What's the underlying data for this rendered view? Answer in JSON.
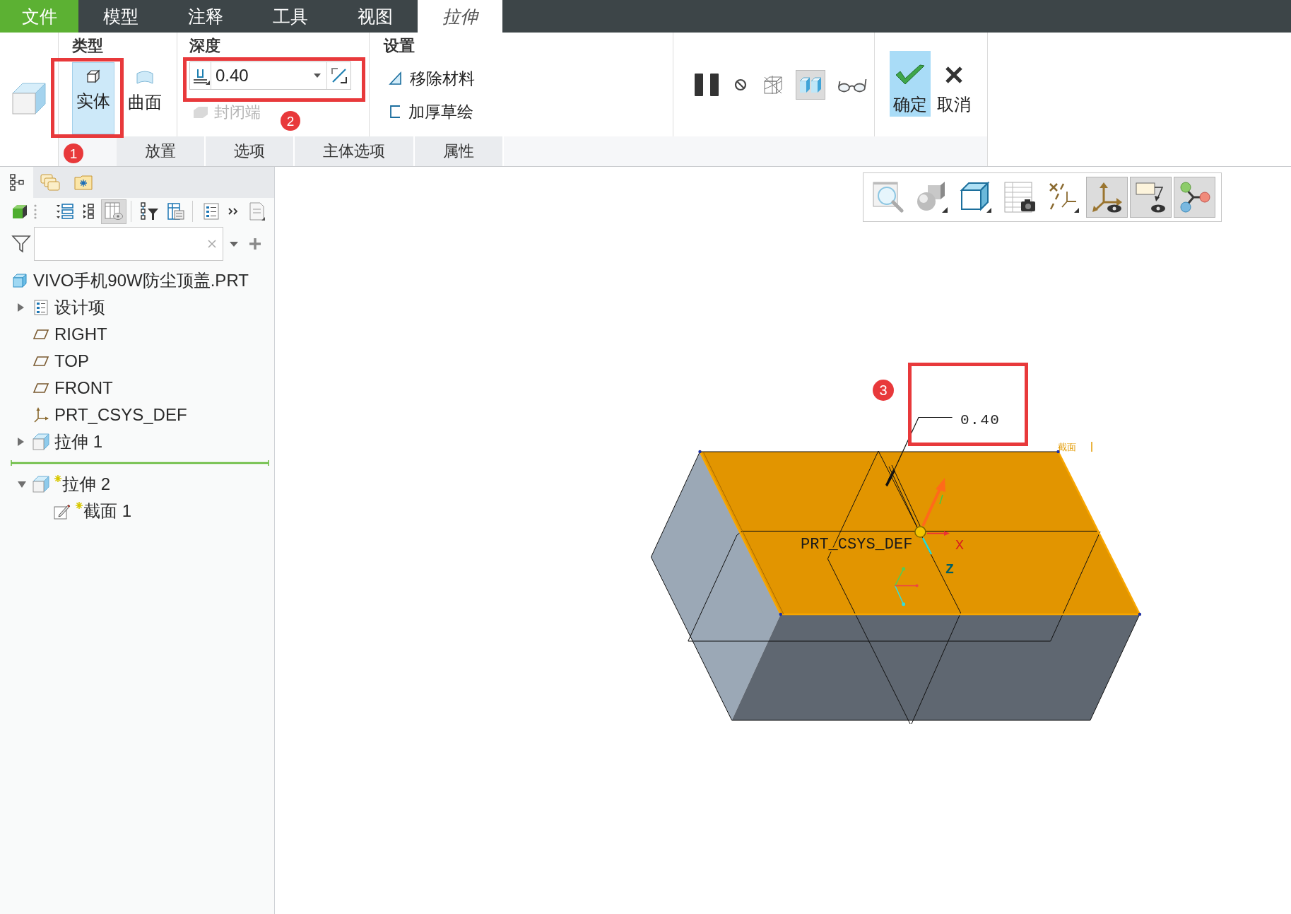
{
  "menu_bar": {
    "tabs": [
      {
        "label": "文件",
        "kind": "file",
        "selected": false
      },
      {
        "label": "模型",
        "kind": "tab",
        "selected": false
      },
      {
        "label": "注释",
        "kind": "tab",
        "selected": false
      },
      {
        "label": "工具",
        "kind": "tab",
        "selected": false
      },
      {
        "label": "视图",
        "kind": "tab",
        "selected": false
      },
      {
        "label": "拉伸",
        "kind": "tab",
        "selected": true
      }
    ]
  },
  "ribbon": {
    "type_group": {
      "title": "类型",
      "options": [
        {
          "label": "实体",
          "kind": "solid",
          "selected": true
        },
        {
          "label": "曲面",
          "kind": "surface",
          "selected": false
        }
      ],
      "callout": {
        "number": "1"
      }
    },
    "depth_group": {
      "title": "深度",
      "value": "0.40",
      "capped_ends": {
        "label": "封闭端",
        "disabled": true
      },
      "callout": {
        "number": "2"
      }
    },
    "settings_group": {
      "title": "设置",
      "options": [
        {
          "label": "移除材料",
          "kind": "remove_material",
          "on": false
        },
        {
          "label": "加厚草绘",
          "kind": "thicken",
          "on": false
        }
      ]
    },
    "preview_tools": [
      {
        "kind": "pause",
        "selected": false
      },
      {
        "kind": "no_preview",
        "selected": false
      },
      {
        "kind": "wireframe",
        "selected": false
      },
      {
        "kind": "verify",
        "selected": true
      },
      {
        "kind": "glasses",
        "selected": false
      }
    ],
    "actions": [
      {
        "label": "确定",
        "kind": "ok",
        "selected": true
      },
      {
        "label": "取消",
        "kind": "cancel",
        "selected": false
      }
    ],
    "sub_tabs": [
      {
        "label": "放置",
        "selected": false
      },
      {
        "label": "选项",
        "selected": false
      },
      {
        "label": "主体选项",
        "selected": false
      },
      {
        "label": "属性",
        "selected": false
      }
    ]
  },
  "model_tree_panel": {
    "panel_tabs": [
      {
        "kind": "model_tree",
        "selected": true
      },
      {
        "kind": "layers",
        "selected": false
      },
      {
        "kind": "folder",
        "selected": false
      }
    ],
    "toolbar": [
      {
        "kind": "display",
        "selected": false
      },
      {
        "kind": "expand",
        "selected": false
      },
      {
        "kind": "collapse",
        "selected": false
      },
      {
        "kind": "columns",
        "selected": true
      },
      {
        "kind": "tree_filter",
        "selected": false
      },
      {
        "kind": "table",
        "selected": false
      },
      {
        "kind": "list",
        "selected": false
      },
      {
        "kind": "more",
        "selected": false
      },
      {
        "kind": "document",
        "selected": false
      }
    ],
    "tree": [
      {
        "label": "VIVO手机90W防尘顶盖.PRT",
        "kind": "part",
        "new": false,
        "children": [
          {
            "label": "设计项",
            "kind": "design_items",
            "new": false,
            "expanded": false
          },
          {
            "label": "RIGHT",
            "kind": "plane",
            "new": false
          },
          {
            "label": "TOP",
            "kind": "plane",
            "new": false
          },
          {
            "label": "FRONT",
            "kind": "plane",
            "new": false
          },
          {
            "label": "PRT_CSYS_DEF",
            "kind": "csys",
            "new": false
          },
          {
            "label": "拉伸 1",
            "kind": "extrude",
            "new": false,
            "expanded": false
          },
          {
            "kind": "insert_marker"
          },
          {
            "label": "拉伸 2",
            "kind": "extrude",
            "new": true,
            "expanded": true,
            "children": [
              {
                "label": "截面 1",
                "kind": "sketch",
                "new": true
              }
            ]
          }
        ]
      }
    ]
  },
  "graphics": {
    "view_toolbar": [
      {
        "kind": "refit",
        "selected": false
      },
      {
        "kind": "appearance",
        "selected": false
      },
      {
        "kind": "display_style",
        "selected": false
      },
      {
        "kind": "saved_views",
        "selected": false
      },
      {
        "kind": "datum_display",
        "selected": false
      },
      {
        "kind": "csys_display",
        "selected": true
      },
      {
        "kind": "annotation_display",
        "selected": true
      },
      {
        "kind": "spin_center",
        "selected": true
      }
    ],
    "model": {
      "dimension": "0.40",
      "csys_label": "PRT_CSYS_DEF",
      "x_axis_label": "X",
      "z_axis_label": "Z",
      "section_label": "截面",
      "callout": {
        "number": "3"
      }
    }
  }
}
